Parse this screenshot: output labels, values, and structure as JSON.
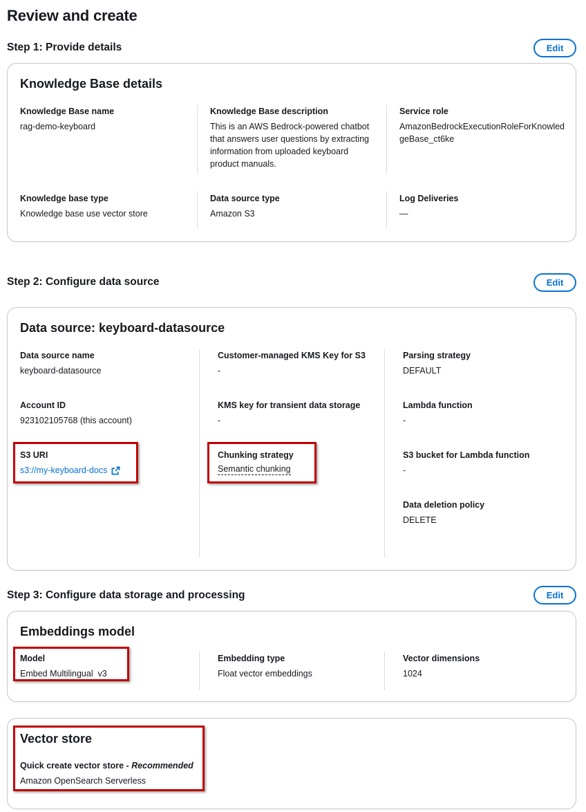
{
  "page_title": "Review and create",
  "edit_label": "Edit",
  "step1": {
    "header": "Step 1: Provide details",
    "card_title": "Knowledge Base details",
    "kb_name_label": "Knowledge Base name",
    "kb_name_value": "rag-demo-keyboard",
    "kb_desc_label": "Knowledge Base description",
    "kb_desc_value": "This is an AWS Bedrock-powered chatbot that answers user questions by extracting information from uploaded keyboard product manuals.",
    "service_role_label": "Service role",
    "service_role_value": "AmazonBedrockExecutionRoleForKnowledgeBase_ct6ke",
    "kb_type_label": "Knowledge base type",
    "kb_type_value": "Knowledge base use vector store",
    "ds_type_label": "Data source type",
    "ds_type_value": "Amazon S3",
    "log_label": "Log Deliveries",
    "log_value": "—"
  },
  "step2": {
    "header": "Step 2: Configure data source",
    "card_title": "Data source: keyboard-datasource",
    "ds_name_label": "Data source name",
    "ds_name_value": "keyboard-datasource",
    "account_label": "Account ID",
    "account_value": "923102105768 (this account)",
    "s3_uri_label": "S3 URI",
    "s3_uri_value": "s3://my-keyboard-docs",
    "kms_s3_label": "Customer-managed KMS Key for S3",
    "kms_s3_value": "-",
    "kms_transient_label": "KMS key for transient data storage",
    "kms_transient_value": "-",
    "chunking_label": "Chunking strategy",
    "chunking_value": "Semantic chunking",
    "parsing_label": "Parsing strategy",
    "parsing_value": "DEFAULT",
    "lambda_label": "Lambda function",
    "lambda_value": "-",
    "s3_lambda_label": "S3 bucket for Lambda function",
    "s3_lambda_value": "-",
    "deletion_label": "Data deletion policy",
    "deletion_value": "DELETE"
  },
  "step3": {
    "header": "Step 3: Configure data storage and processing",
    "embed_title": "Embeddings model",
    "model_label": "Model",
    "model_value": "Embed Multilingual  v3",
    "embed_type_label": "Embedding type",
    "embed_type_value": "Float vector embeddings",
    "vector_dim_label": "Vector dimensions",
    "vector_dim_value": "1024",
    "vector_title": "Vector store",
    "quick_create_label": "Quick create vector store - ",
    "quick_create_recommended": "Recommended",
    "vector_store_value": "Amazon OpenSearch Serverless"
  },
  "colors": {
    "link": "#0972d3",
    "highlight": "#c00000",
    "border": "#c6c6cd"
  }
}
